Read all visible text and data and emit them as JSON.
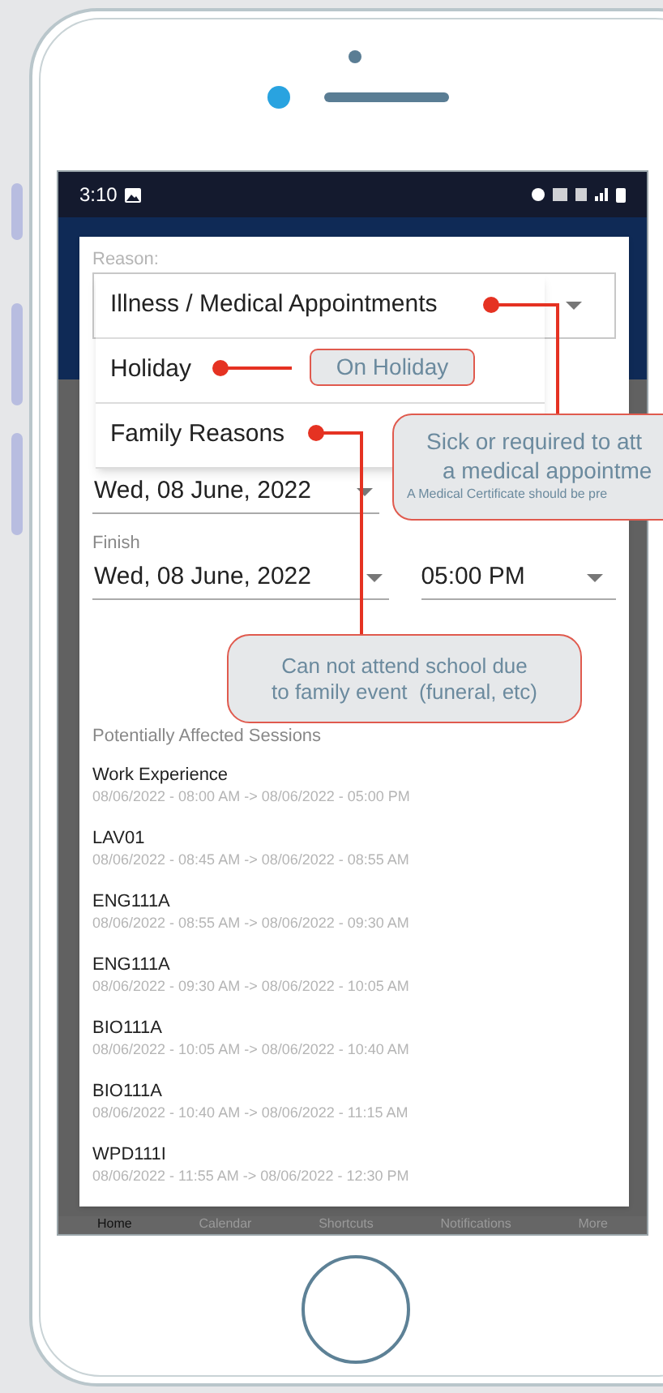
{
  "status_bar": {
    "time": "3:10"
  },
  "dialog": {
    "reason_label": "Reason:",
    "reason_options": [
      {
        "label": "Illness / Medical Appointments"
      },
      {
        "label": "Holiday"
      },
      {
        "label": "Family Reasons"
      }
    ],
    "start": {
      "date": "Wed, 08 June, 2022"
    },
    "finish_label": "Finish",
    "finish": {
      "date": "Wed, 08 June, 2022",
      "time": "05:00 PM"
    },
    "sessions_label": "Potentially Affected Sessions",
    "sessions": [
      {
        "name": "Work Experience",
        "time": "08/06/2022 - 08:00 AM -> 08/06/2022 - 05:00 PM"
      },
      {
        "name": "LAV01",
        "time": "08/06/2022 - 08:45 AM -> 08/06/2022 - 08:55 AM"
      },
      {
        "name": "ENG111A",
        "time": "08/06/2022 - 08:55 AM -> 08/06/2022 - 09:30 AM"
      },
      {
        "name": "ENG111A",
        "time": "08/06/2022 - 09:30 AM -> 08/06/2022 - 10:05 AM"
      },
      {
        "name": "BIO111A",
        "time": "08/06/2022 - 10:05 AM -> 08/06/2022 - 10:40 AM"
      },
      {
        "name": "BIO111A",
        "time": "08/06/2022 - 10:40 AM -> 08/06/2022 - 11:15 AM"
      },
      {
        "name": "WPD111I",
        "time": "08/06/2022 - 11:55 AM -> 08/06/2022 - 12:30 PM"
      }
    ]
  },
  "bottom_nav": [
    {
      "label": "Home",
      "selected": true
    },
    {
      "label": "Calendar",
      "selected": false
    },
    {
      "label": "Shortcuts",
      "selected": false
    },
    {
      "label": "Notifications",
      "selected": false
    },
    {
      "label": "More",
      "selected": false
    }
  ],
  "annotations": {
    "holiday": "On Holiday",
    "illness": {
      "lines": [
        "Sick or required to att",
        "a medical appointme"
      ],
      "note": "A Medical Certificate should be pre"
    },
    "family": {
      "lines": [
        "Can not attend school due",
        "to family event  (funeral, etc)"
      ]
    }
  }
}
